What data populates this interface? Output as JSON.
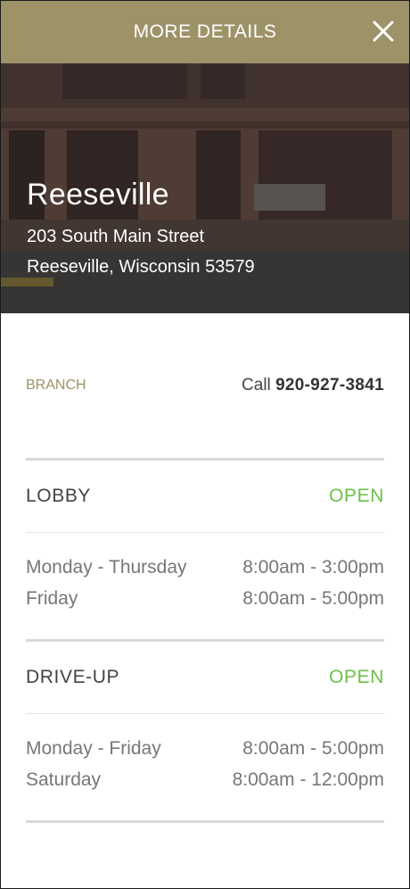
{
  "header": {
    "title": "MORE DETAILS"
  },
  "icons": {
    "close": "close-icon"
  },
  "colors": {
    "header_bg": "#9e9268",
    "accent": "#9e9268",
    "open": "#6cc04a"
  },
  "location": {
    "name": "Reeseville",
    "address_line1": "203 South Main Street",
    "address_line2": "Reeseville, Wisconsin 53579"
  },
  "branch": {
    "label": "BRANCH",
    "call_prefix": "Call",
    "phone": "920-927-3841"
  },
  "lobby": {
    "title": "LOBBY",
    "status": "OPEN",
    "hours": [
      {
        "days": "Monday - Thursday",
        "time": "8:00am - 3:00pm"
      },
      {
        "days": "Friday",
        "time": "8:00am - 5:00pm"
      }
    ]
  },
  "driveup": {
    "title": "DRIVE-UP",
    "status": "OPEN",
    "hours": [
      {
        "days": "Monday - Friday",
        "time": "8:00am - 5:00pm"
      },
      {
        "days": "Saturday",
        "time": "8:00am - 12:00pm"
      }
    ]
  }
}
